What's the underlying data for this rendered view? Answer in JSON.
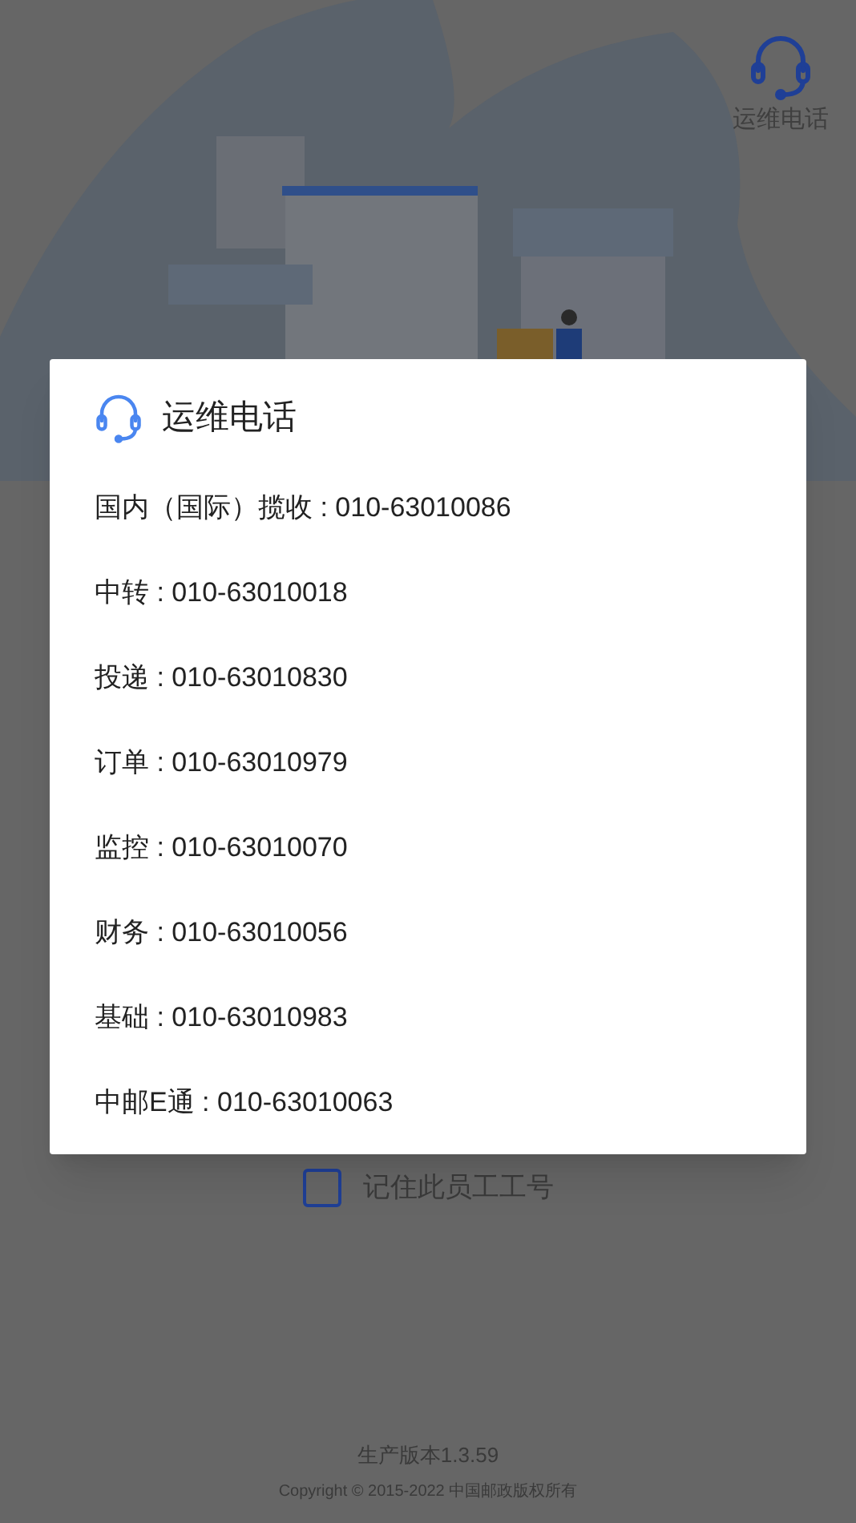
{
  "header": {
    "support_label": "运维电话"
  },
  "dialog": {
    "title": "运维电话",
    "contacts": [
      {
        "label": "国内（国际）揽收 : 010-63010086"
      },
      {
        "label": "中转 : 010-63010018"
      },
      {
        "label": "投递 : 010-63010830"
      },
      {
        "label": "订单 : 010-63010979"
      },
      {
        "label": "监控 : 010-63010070"
      },
      {
        "label": "财务 : 010-63010056"
      },
      {
        "label": "基础 : 010-63010983"
      },
      {
        "label": "中邮E通 : 010-63010063"
      }
    ]
  },
  "remember": {
    "label": "记住此员工工号",
    "checked": false
  },
  "footer": {
    "version": "生产版本1.3.59",
    "copyright": "Copyright © 2015-2022 中国邮政版权所有"
  }
}
